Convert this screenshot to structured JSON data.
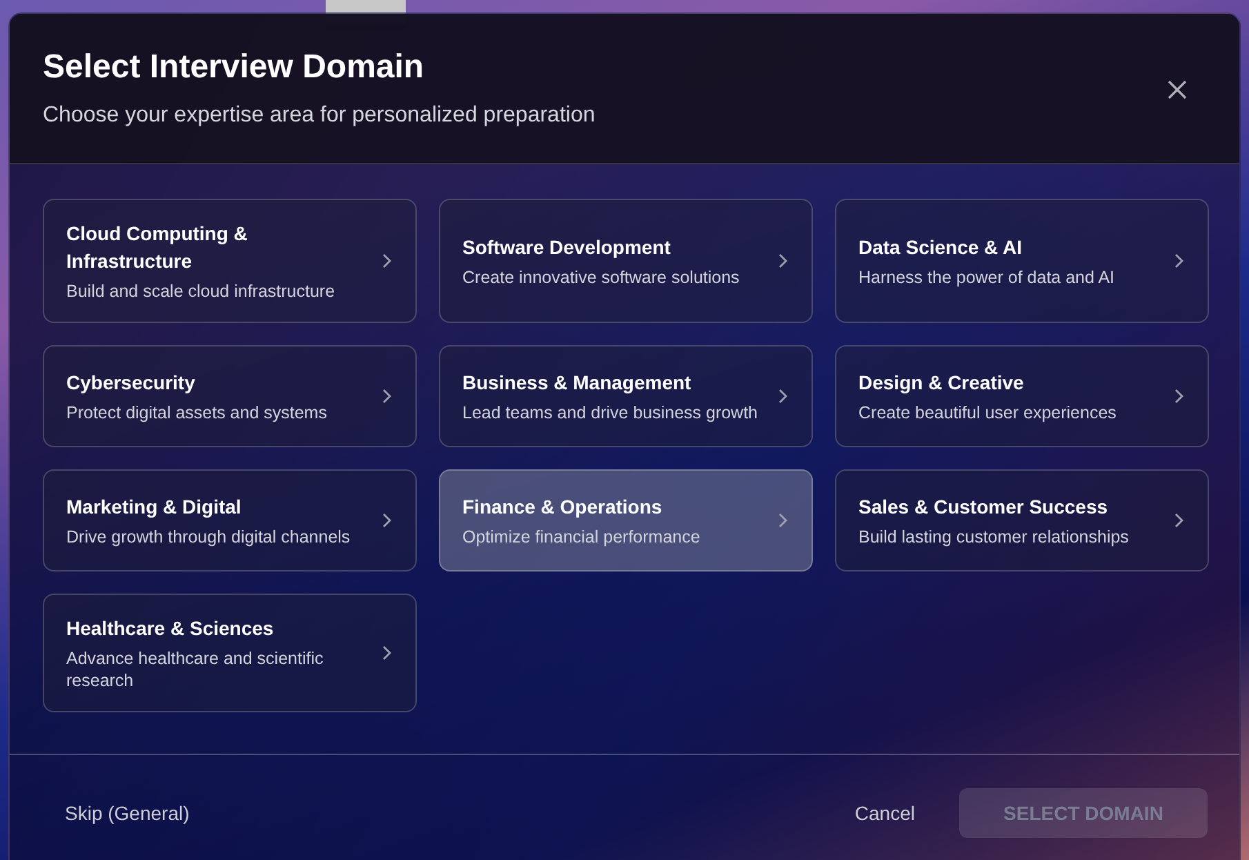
{
  "dialog": {
    "title": "Select Interview Domain",
    "subtitle": "Choose your expertise area for personalized preparation"
  },
  "domains": [
    {
      "title": "Cloud Computing & Infrastructure",
      "description": "Build and scale cloud infrastructure",
      "selected": false
    },
    {
      "title": "Software Development",
      "description": "Create innovative software solutions",
      "selected": false
    },
    {
      "title": "Data Science & AI",
      "description": "Harness the power of data and AI",
      "selected": false
    },
    {
      "title": "Cybersecurity",
      "description": "Protect digital assets and systems",
      "selected": false
    },
    {
      "title": "Business & Management",
      "description": "Lead teams and drive business growth",
      "selected": false
    },
    {
      "title": "Design & Creative",
      "description": "Create beautiful user experiences",
      "selected": false
    },
    {
      "title": "Marketing & Digital",
      "description": "Drive growth through digital channels",
      "selected": false
    },
    {
      "title": "Finance & Operations",
      "description": "Optimize financial performance",
      "selected": true
    },
    {
      "title": "Sales & Customer Success",
      "description": "Build lasting customer relationships",
      "selected": false
    },
    {
      "title": "Healthcare & Sciences",
      "description": "Advance healthcare and scientific research",
      "selected": false
    }
  ],
  "footer": {
    "skip": "Skip (General)",
    "cancel": "Cancel",
    "submit": {
      "label": "SELECT DOMAIN",
      "disabled": true
    }
  }
}
